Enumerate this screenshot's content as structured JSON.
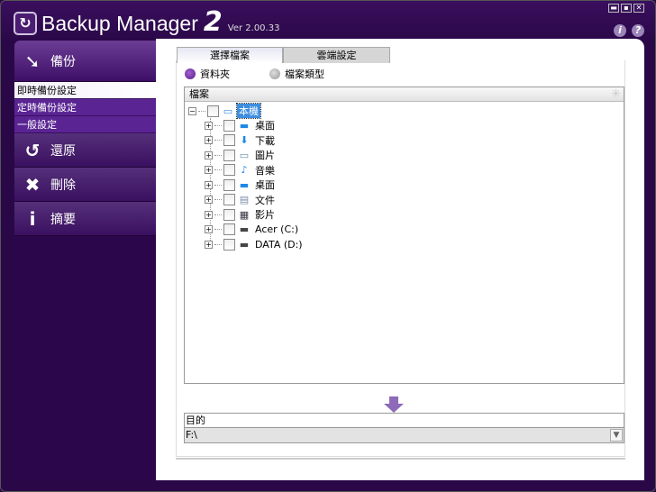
{
  "app": {
    "title": "Backup Manager",
    "big_number": "2",
    "version": "Ver 2.00.33",
    "logo_icon": "backup-logo-icon"
  },
  "window_controls": {
    "minimize": "▬",
    "maximize": "▪",
    "close": "✕",
    "info": "i",
    "help": "?"
  },
  "sidebar": {
    "backup": "備份",
    "sub_items": [
      {
        "label": "即時備份設定",
        "selected": true
      },
      {
        "label": "定時備份設定"
      },
      {
        "label": "一般設定"
      }
    ],
    "restore": "還原",
    "delete": "刪除",
    "summary": "摘要"
  },
  "tabs": [
    {
      "label": "選擇檔案",
      "active": true
    },
    {
      "label": "雲端設定"
    }
  ],
  "radios": [
    {
      "label": "資料夾",
      "checked": true
    },
    {
      "label": "檔案類型",
      "checked": false
    }
  ],
  "tree": {
    "header": "檔案",
    "root": "本機",
    "items": [
      {
        "label": "桌面",
        "icon": "desktop-icon",
        "glyph": "▬"
      },
      {
        "label": "下載",
        "icon": "download-icon",
        "glyph": "⬇"
      },
      {
        "label": "圖片",
        "icon": "picture-icon",
        "glyph": "▭"
      },
      {
        "label": "音樂",
        "icon": "music-icon",
        "glyph": "♪"
      },
      {
        "label": "桌面",
        "icon": "desktop-icon",
        "glyph": "▬"
      },
      {
        "label": "文件",
        "icon": "document-icon",
        "glyph": "▤"
      },
      {
        "label": "影片",
        "icon": "video-icon",
        "glyph": "▦"
      },
      {
        "label": "Acer (C:)",
        "icon": "drive-icon",
        "glyph": "▬"
      },
      {
        "label": "DATA (D:)",
        "icon": "drive-icon",
        "glyph": "▬"
      }
    ]
  },
  "destination": {
    "label": "目的",
    "value": "F:\\"
  },
  "colors": {
    "frame": "#2a0848",
    "accent": "#5a2493",
    "arrow": "#8e6ab8"
  }
}
